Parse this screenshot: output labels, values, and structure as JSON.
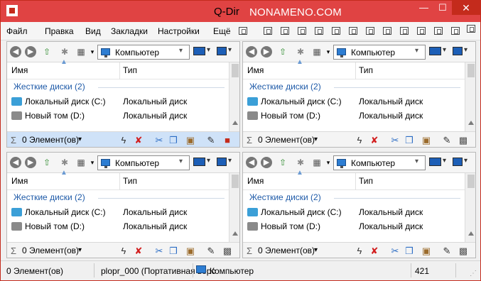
{
  "window": {
    "title": "Q-Dir",
    "watermark": "NONAMENO.COM",
    "min": "—",
    "max": "☐",
    "close": "✕"
  },
  "menu": [
    "Файл",
    "Правка",
    "Вид",
    "Закладки",
    "Настройки",
    "Ещё"
  ],
  "pane": {
    "address": "Компьютер",
    "columns": {
      "name": "Имя",
      "type": "Тип"
    },
    "group": "Жесткие диски (2)",
    "rows": [
      {
        "name": "Локальный диск (C:)",
        "type": "Локальный диск"
      },
      {
        "name": "Новый том (D:)",
        "type": "Локальный диск"
      }
    ],
    "status": "0 Элемент(ов)"
  },
  "statusbar": {
    "items": "0 Элемент(ов)",
    "plugin": "plopr_000 (Портативная верс",
    "location": "Компьютер",
    "number": "421"
  },
  "colors": {
    "titlebar": "#e04343",
    "close": "#c42b1c",
    "activePaneStatus": "#cfe2f8",
    "group": "#1e5aa8"
  },
  "icons": {
    "back": "back-arrow-icon",
    "forward": "forward-arrow-icon",
    "up": "up-folder-icon",
    "cut": "scissors-icon",
    "copy": "copy-icon",
    "paste": "paste-icon",
    "delete": "delete-x-icon"
  }
}
